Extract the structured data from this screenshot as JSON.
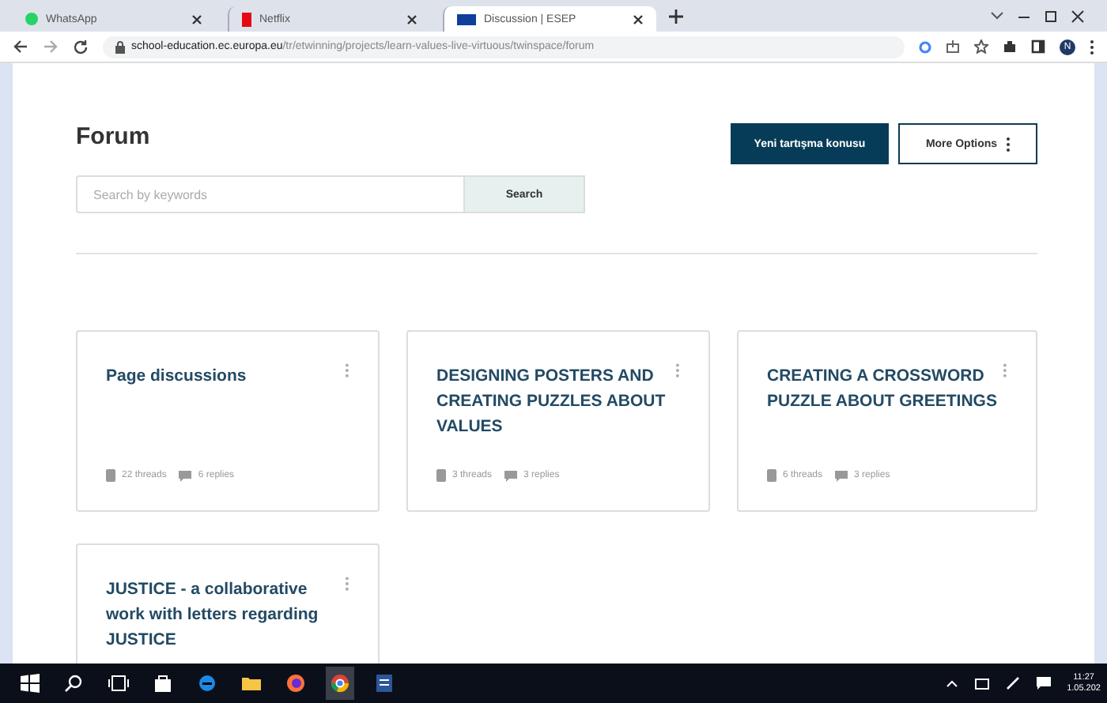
{
  "browser": {
    "tabs": [
      {
        "title": "WhatsApp",
        "kind": "whatsapp",
        "selected": false
      },
      {
        "title": "Netflix",
        "kind": "netflix",
        "selected": false
      },
      {
        "title": "Discussion | ESEP",
        "kind": "flag",
        "selected": true
      }
    ],
    "url": {
      "host": "school-education.ec.europa.eu",
      "path": "/tr/etwinning/projects/learn-values-live-virtuous/twinspace/forum"
    },
    "profile": "N"
  },
  "page": {
    "title": "Forum",
    "search": {
      "placeholder": "Search by keywords",
      "button": "Search"
    },
    "buttons": [
      {
        "label": "Yeni tartışma konusu",
        "kind": "primary"
      },
      {
        "label": "More Options",
        "kind": "outline"
      }
    ],
    "forums": [
      {
        "title": "Page discussions",
        "threads": "22 threads",
        "replies": "6 replies"
      },
      {
        "title": "DESIGNING POSTERS AND CREATING PUZZLES ABOUT VALUES",
        "threads": "3 threads",
        "replies": "3 replies"
      },
      {
        "title": "CREATING A CROSSWORD PUZZLE ABOUT GREETINGS",
        "threads": "6 threads",
        "replies": "3 replies"
      },
      {
        "title": "JUSTICE - a collaborative work with letters regarding JUSTICE"
      }
    ]
  },
  "taskbar": {
    "apps": [
      {
        "kind": "start",
        "selected": false
      },
      {
        "kind": "search",
        "selected": false
      },
      {
        "kind": "taskview",
        "selected": false
      },
      {
        "kind": "store",
        "selected": false
      },
      {
        "kind": "edge",
        "selected": false
      },
      {
        "kind": "files",
        "selected": false
      },
      {
        "kind": "firefox",
        "selected": false
      },
      {
        "kind": "chrome",
        "selected": true
      },
      {
        "kind": "word",
        "selected": false
      }
    ],
    "time": "11:27",
    "date": "1.05.202"
  }
}
